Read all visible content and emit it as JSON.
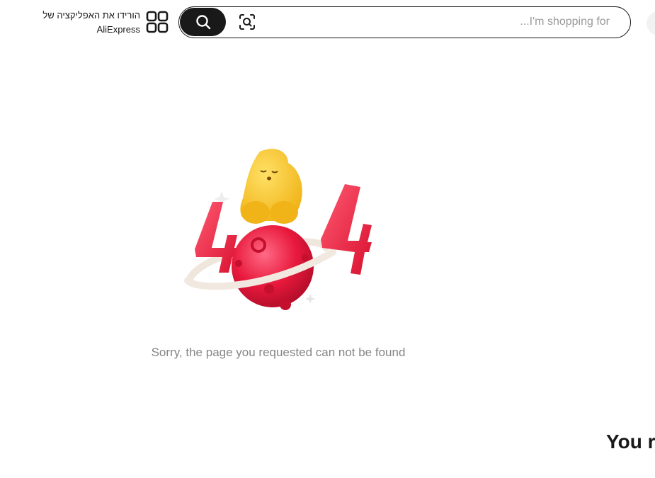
{
  "header": {
    "app_promo_line1": "הורידו את האפליקציה של",
    "app_promo_line2": "AliExpress",
    "qr_icon": "qr-code-icon",
    "search": {
      "placeholder": "...I'm shopping for",
      "value": "",
      "search_icon": "search-icon",
      "camera_icon": "image-search-icon"
    }
  },
  "main": {
    "illustration": "404-illustration",
    "error_message": "Sorry, the page you requested can not be found",
    "section_title": "You r"
  },
  "colors": {
    "text": "#191919",
    "muted": "#858585",
    "placeholder": "#999999",
    "accent_red": "#e8193c",
    "mascot_yellow": "#f7c824"
  }
}
